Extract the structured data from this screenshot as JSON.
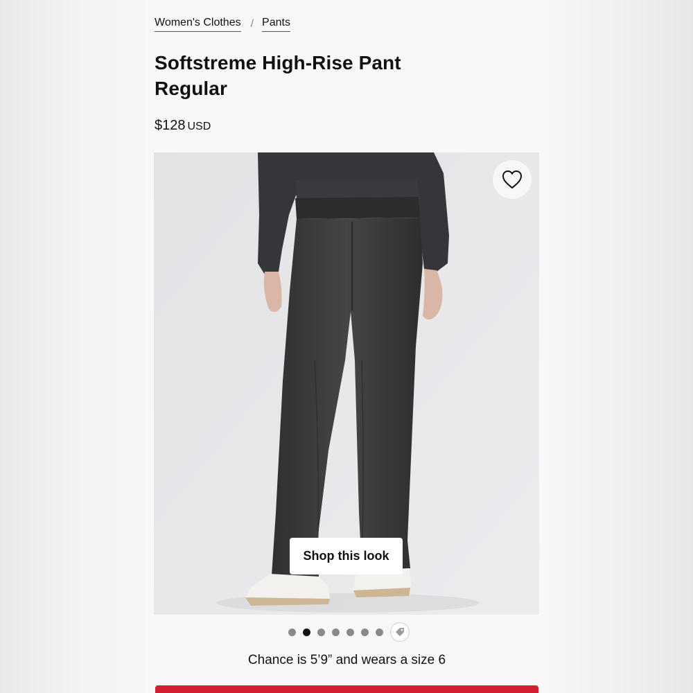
{
  "breadcrumb": {
    "items": [
      "Women's Clothes",
      "Pants"
    ],
    "separator": "/"
  },
  "product": {
    "title_line1": "Softstreme High-Rise Pant",
    "title_line2": "Regular",
    "price": "$128",
    "currency": "USD"
  },
  "gallery": {
    "shop_look_label": "Shop this look",
    "wishlist_icon": "heart-icon",
    "image_count": 8,
    "active_index": 1,
    "last_icon": "tag-icon",
    "caption": "Chance is 5’9” and wears a size 6"
  },
  "colors": {
    "cta": "#d31e32",
    "garment": "#3b3c3e"
  }
}
